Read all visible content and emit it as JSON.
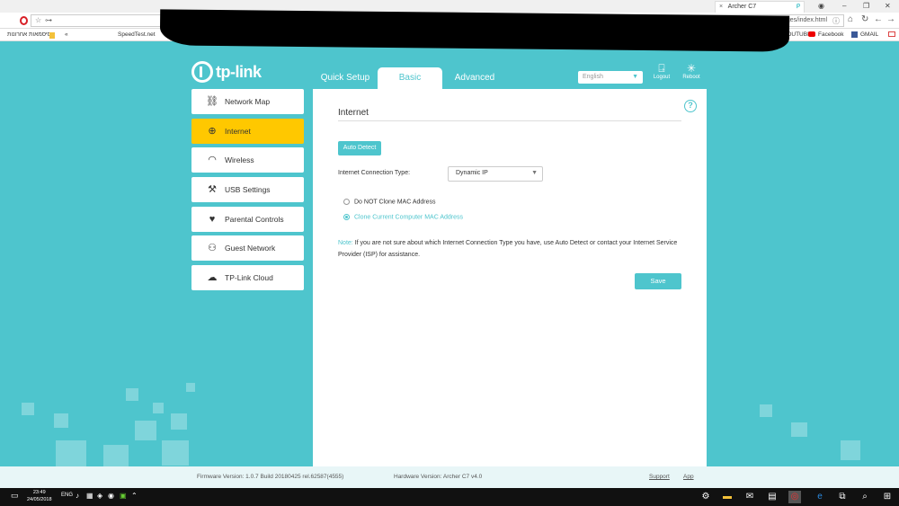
{
  "browser": {
    "tab_title": "Archer C7",
    "tab_close": "×",
    "url": "192.168.0.1/webpages/index.html",
    "bookmarks": [
      {
        "label": "סיסמאות אחרונות"
      },
      {
        "label": "«"
      },
      {
        "label": "SpeedTest.net"
      },
      {
        "label": "YOUTUBE"
      },
      {
        "label": "Facebook"
      },
      {
        "label": "GMAIL"
      }
    ]
  },
  "header": {
    "logo_text": "tp-link",
    "tabs": [
      {
        "label": "Quick Setup"
      },
      {
        "label": "Basic"
      },
      {
        "label": "Advanced"
      }
    ],
    "language": "English",
    "logout_label": "Logout",
    "reboot_label": "Reboot"
  },
  "sidebar": {
    "items": [
      {
        "label": "Network Map",
        "icon": "network-map-icon"
      },
      {
        "label": "Internet",
        "icon": "globe-icon"
      },
      {
        "label": "Wireless",
        "icon": "wifi-icon"
      },
      {
        "label": "USB Settings",
        "icon": "usb-icon"
      },
      {
        "label": "Parental Controls",
        "icon": "heart-icon"
      },
      {
        "label": "Guest Network",
        "icon": "guest-icon"
      },
      {
        "label": "TP-Link Cloud",
        "icon": "cloud-icon"
      }
    ],
    "active": "Internet"
  },
  "main": {
    "title": "Internet",
    "auto_detect_label": "Auto Detect",
    "connection_type_label": "Internet Connection Type:",
    "connection_type_value": "Dynamic IP",
    "radio_options": [
      {
        "label": "Do NOT Clone MAC Address",
        "selected": false
      },
      {
        "label": "Clone Current Computer MAC Address",
        "selected": true
      }
    ],
    "note_label": "Note:",
    "note_text": "If you are not sure about which Internet Connection Type you have, use Auto Detect or contact your Internet Service Provider (ISP) for assistance.",
    "save_label": "Save"
  },
  "footer": {
    "firmware": "Firmware Version: 1.0.7 Build 20180425 rel.62587(4555)",
    "hardware": "Hardware Version: Archer C7 v4.0",
    "support_label": "Support",
    "app_label": "App"
  },
  "taskbar": {
    "time": "23:49",
    "date": "24/05/2018",
    "lang": "ENG"
  },
  "colors": {
    "accent": "#4ec5cd",
    "active_sidebar": "#ffc800",
    "panel_bg": "#ffffff"
  }
}
